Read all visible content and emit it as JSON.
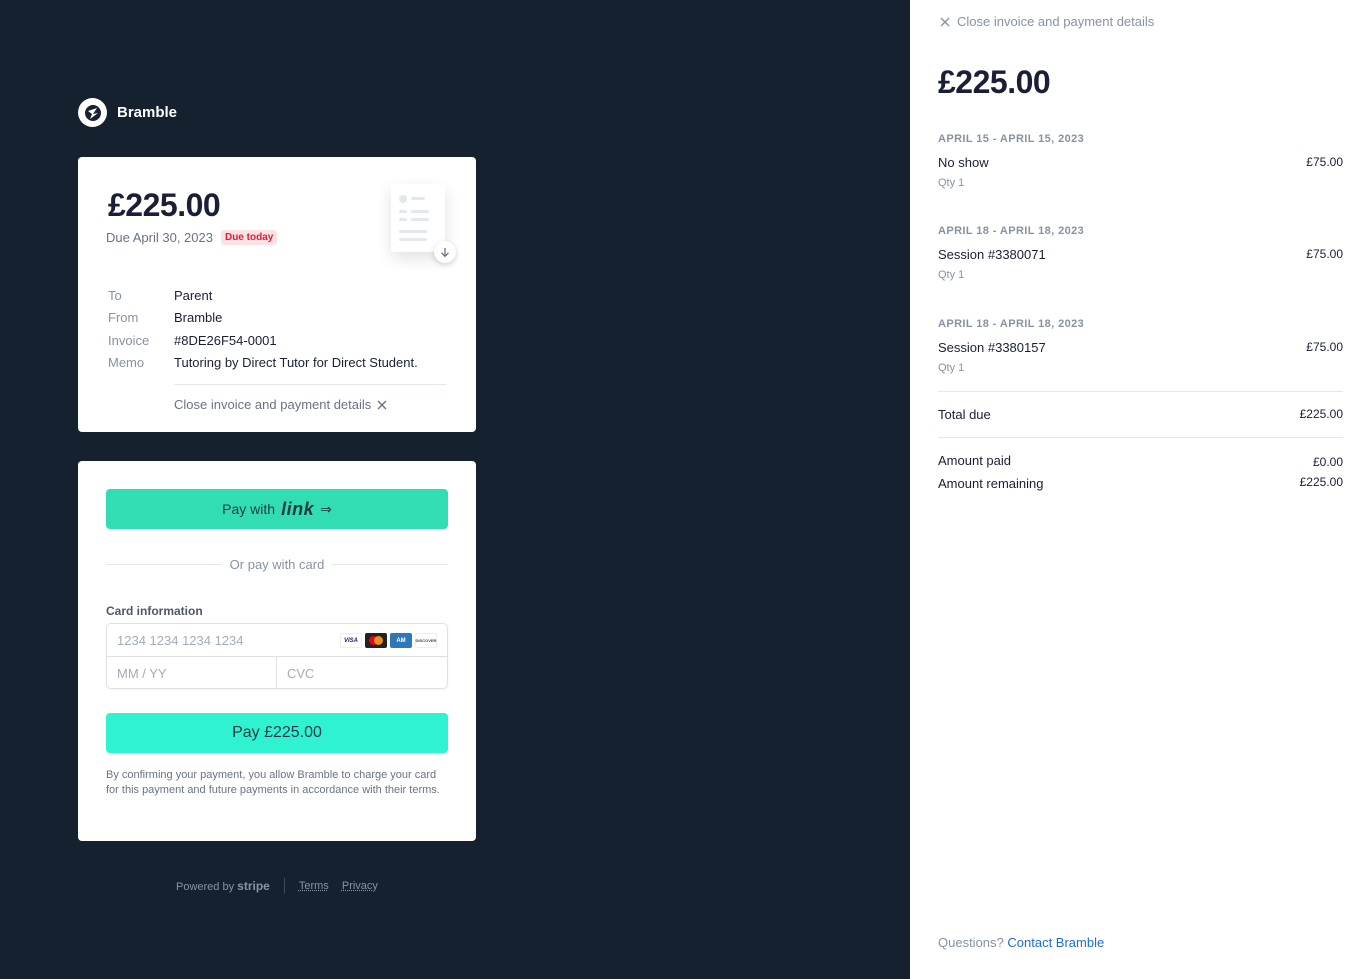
{
  "brand": {
    "name": "Bramble"
  },
  "invoice": {
    "amount": "£225.00",
    "due_text": "Due April 30, 2023",
    "due_badge": "Due today",
    "details": [
      {
        "key": "To",
        "value": "Parent"
      },
      {
        "key": "From",
        "value": "Bramble"
      },
      {
        "key": "Invoice",
        "value": "#8DE26F54-0001"
      },
      {
        "key": "Memo",
        "value": "Tutoring by Direct Tutor for Direct Student."
      }
    ],
    "close_label": "Close invoice and payment details"
  },
  "payment": {
    "link_prefix": "Pay with",
    "link_brand": "link",
    "or_text": "Or pay with card",
    "card_label": "Card information",
    "card_number_placeholder": "1234 1234 1234 1234",
    "expiry_placeholder": "MM / YY",
    "cvc_placeholder": "CVC",
    "card_brands": [
      "VISA",
      "mastercard",
      "amex",
      "discover"
    ],
    "pay_label": "Pay £225.00",
    "disclaimer": "By confirming your payment, you allow Bramble to charge your card for this payment and future payments in accordance with their terms."
  },
  "footer": {
    "powered_by": "Powered by",
    "stripe": "stripe",
    "terms": "Terms",
    "privacy": "Privacy"
  },
  "panel": {
    "close_label": "Close invoice and payment details",
    "amount": "£225.00",
    "items": [
      {
        "date": "April 15 - April 15, 2023",
        "name": "No show",
        "qty": "Qty 1",
        "price": "£75.00"
      },
      {
        "date": "April 18 - April 18, 2023",
        "name": "Session #3380071",
        "qty": "Qty 1",
        "price": "£75.00"
      },
      {
        "date": "April 18 - April 18, 2023",
        "name": "Session #3380157",
        "qty": "Qty 1",
        "price": "£75.00"
      }
    ],
    "total_due_label": "Total due",
    "total_due_value": "£225.00",
    "amount_paid_label": "Amount paid",
    "amount_paid_value": "£0.00",
    "amount_remaining_label": "Amount remaining",
    "amount_remaining_value": "£225.00",
    "questions_text": "Questions?",
    "contact_label": "Contact Bramble"
  }
}
